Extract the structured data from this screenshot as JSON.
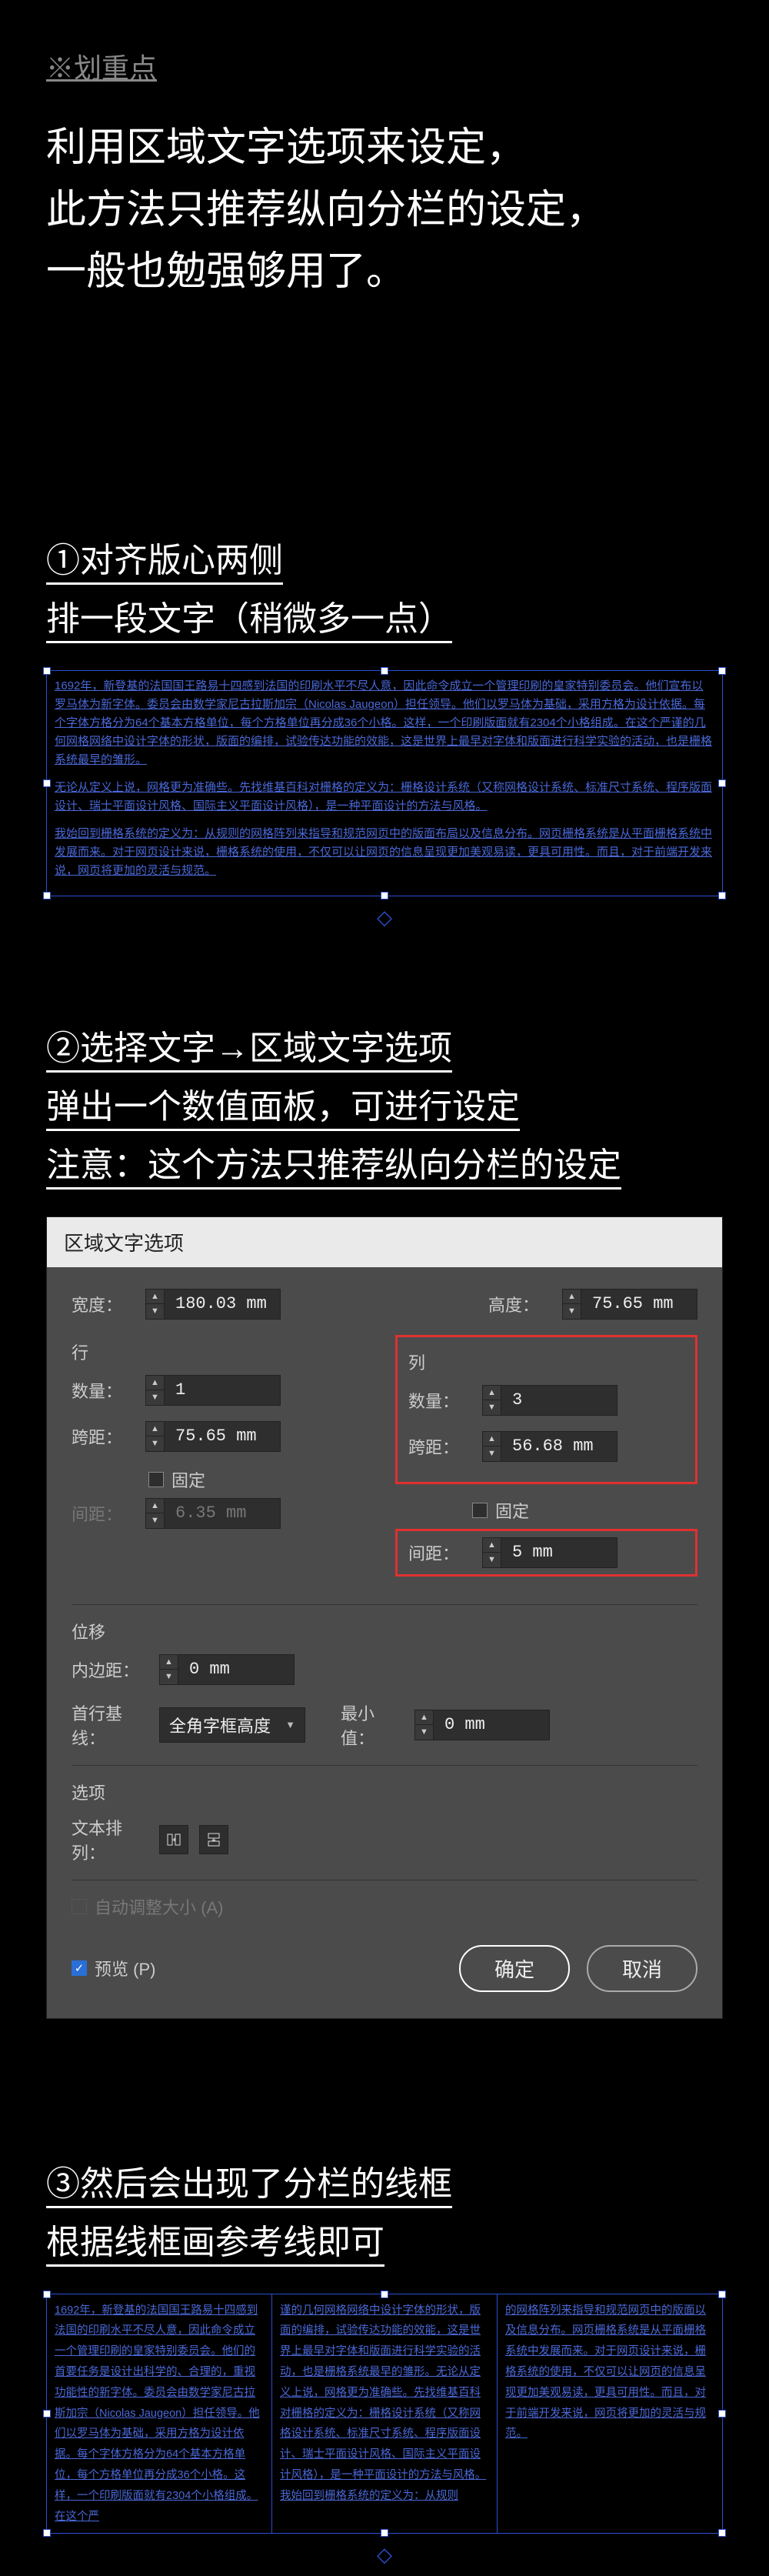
{
  "header": {
    "tag": "※划重点",
    "desc_l1": "利用区域文字选项来设定，",
    "desc_l2": "此方法只推荐纵向分栏的设定，",
    "desc_l3": "一般也勉强够用了。"
  },
  "step1": {
    "line1": "①对齐版心两侧",
    "line2": "排一段文字（稍微多一点）",
    "para1": "1692年，新登基的法国国王路易十四感到法国的印刷水平不尽人意，因此命令成立一个管理印刷的皇家特别委员会。他们宣布以罗马体为新字体。委员会由数学家尼古拉斯加宗（Nicolas Jaugeon）担任领导。他们以罗马体为基础，采用方格为设计依据。每个字体方格分为64个基本方格单位，每个方格单位再分成36个小格。这样，一个印刷版面就有2304个小格组成。在这个严谨的几何网格网络中设计字体的形状，版面的编排，试验传达功能的效能，这是世界上最早对字体和版面进行科学实验的活动，也是栅格系统最早的雏形。",
    "para2": "无论从定义上说，网格更为准确些。先找维基百科对栅格的定义为：栅格设计系统（又称网格设计系统、标准尺寸系统、程序版面设计、瑞士平面设计风格、国际主义平面设计风格），是一种平面设计的方法与风格。",
    "para3": "我始回到栅格系统的定义为：从规则的网格阵列来指导和规范网页中的版面布局以及信息分布。网页栅格系统是从平面栅格系统中发展而来。对于网页设计来说，栅格系统的使用，不仅可以让网页的信息呈现更加美观易读，更具可用性。而且，对于前端开发来说，网页将更加的灵活与规范。"
  },
  "step2": {
    "line1": "②选择文字→区域文字选项",
    "line2": "弹出一个数值面板，可进行设定",
    "line3": "注意：这个方法只推荐纵向分栏的设定"
  },
  "dialog": {
    "title": "区域文字选项",
    "width_label": "宽度：",
    "width_val": "180.03 mm",
    "height_label": "高度：",
    "height_val": "75.65 mm",
    "row_section": "行",
    "col_section": "列",
    "count_label": "数量：",
    "row_count": "1",
    "col_count": "3",
    "span_label": "跨距：",
    "row_span": "75.65 mm",
    "col_span": "56.68 mm",
    "fixed": "固定",
    "gap_label": "间距：",
    "row_gap": "6.35 mm",
    "col_gap": "5 mm",
    "offset_section": "位移",
    "inset_label": "内边距：",
    "inset_val": "0 mm",
    "baseline_label": "首行基线：",
    "baseline_val": "全角字框高度",
    "min_label": "最小值：",
    "min_val": "0 mm",
    "options_section": "选项",
    "textflow_label": "文本排列：",
    "autosize": "自动调整大小 (A)",
    "preview": "预览 (P)",
    "ok": "确定",
    "cancel": "取消"
  },
  "step3": {
    "line1": "③然后会出现了分栏的线框",
    "line2": "根据线框画参考线即可",
    "col1": "1692年，新登基的法国国王路易十四感到法国的印刷水平不尽人意，因此命令成立一个管理印刷的皇家特别委员会。他们的首要任务是设计出科学的、合理的，重视功能性的新字体。委员会由数学家尼古拉斯加宗（Nicolas Jaugeon）担任领导。他们以罗马体为基础，采用方格为设计依据。每个字体方格分为64个基本方格单位，每个方格单位再分成36个小格。这样，一个印刷版面就有2304个小格组成。在这个严",
    "col2": "谨的几何网格网络中设计字体的形状，版面的编排，试验传达功能的效能，这是世界上最早对字体和版面进行科学实验的活动，也是栅格系统最早的雏形。无论从定义上说，网格更为准确些。先找维基百科对栅格的定义为：栅格设计系统（又称网格设计系统、标准尺寸系统、程序版面设计、瑞士平面设计风格、国际主义平面设计风格），是一种平面设计的方法与风格。我始回到栅格系统的定义为：从规则",
    "col3": "的网格阵列来指导和规范网页中的版面以及信息分布。网页栅格系统是从平面栅格系统中发展而来。对于网页设计来说，栅格系统的使用，不仅可以让网页的信息呈现更加美观易读，更具可用性。而且，对于前端开发来说，网页将更加的灵活与规范。"
  }
}
